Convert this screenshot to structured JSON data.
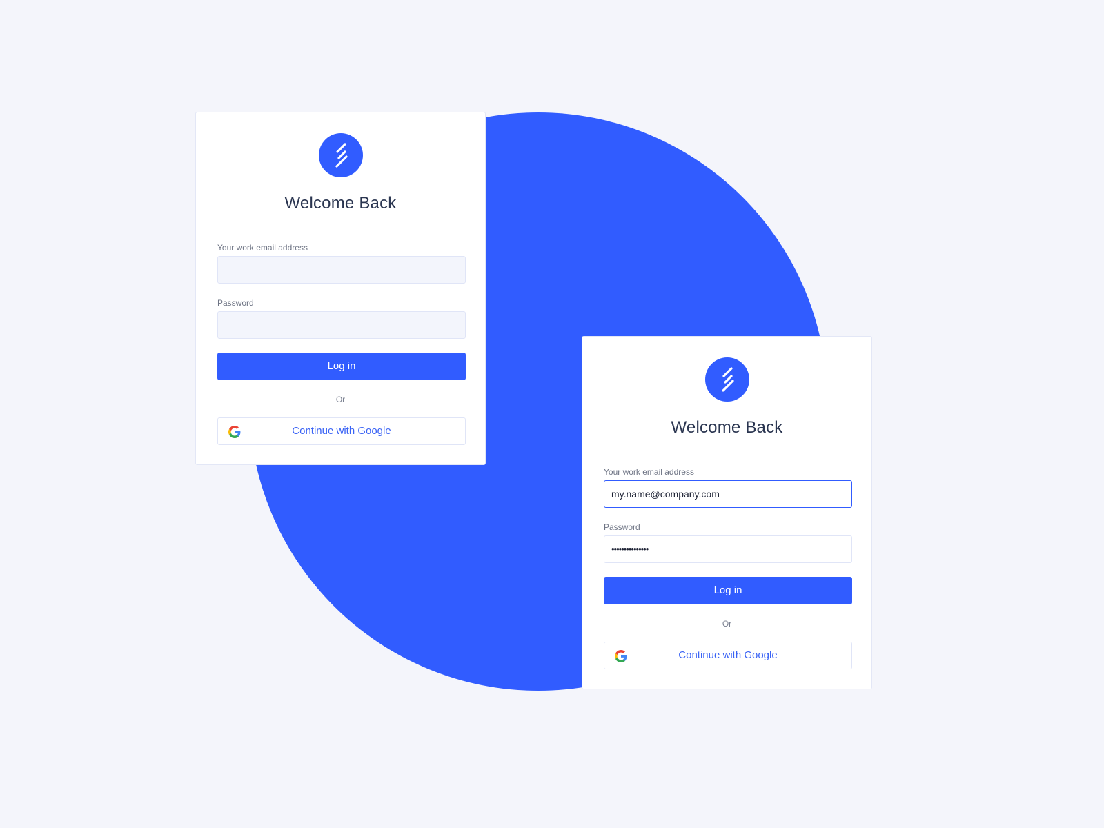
{
  "theme": {
    "accent": "#315cff",
    "background": "#f4f5fb"
  },
  "cards": [
    {
      "logo_icon": "brand-stripes-icon",
      "title": "Welcome Back",
      "email_label": "Your work email address",
      "email_value": "",
      "password_label": "Password",
      "password_value": "",
      "login_label": "Log in",
      "or_label": "Or",
      "google_label": "Continue with Google",
      "google_icon": "google-g-icon"
    },
    {
      "logo_icon": "brand-stripes-icon",
      "title": "Welcome Back",
      "email_label": "Your work email address",
      "email_value": "my.name@company.com",
      "password_label": "Password",
      "password_value": "•••••••••••••••",
      "login_label": "Log in",
      "or_label": "Or",
      "google_label": "Continue with Google",
      "google_icon": "google-g-icon"
    }
  ]
}
